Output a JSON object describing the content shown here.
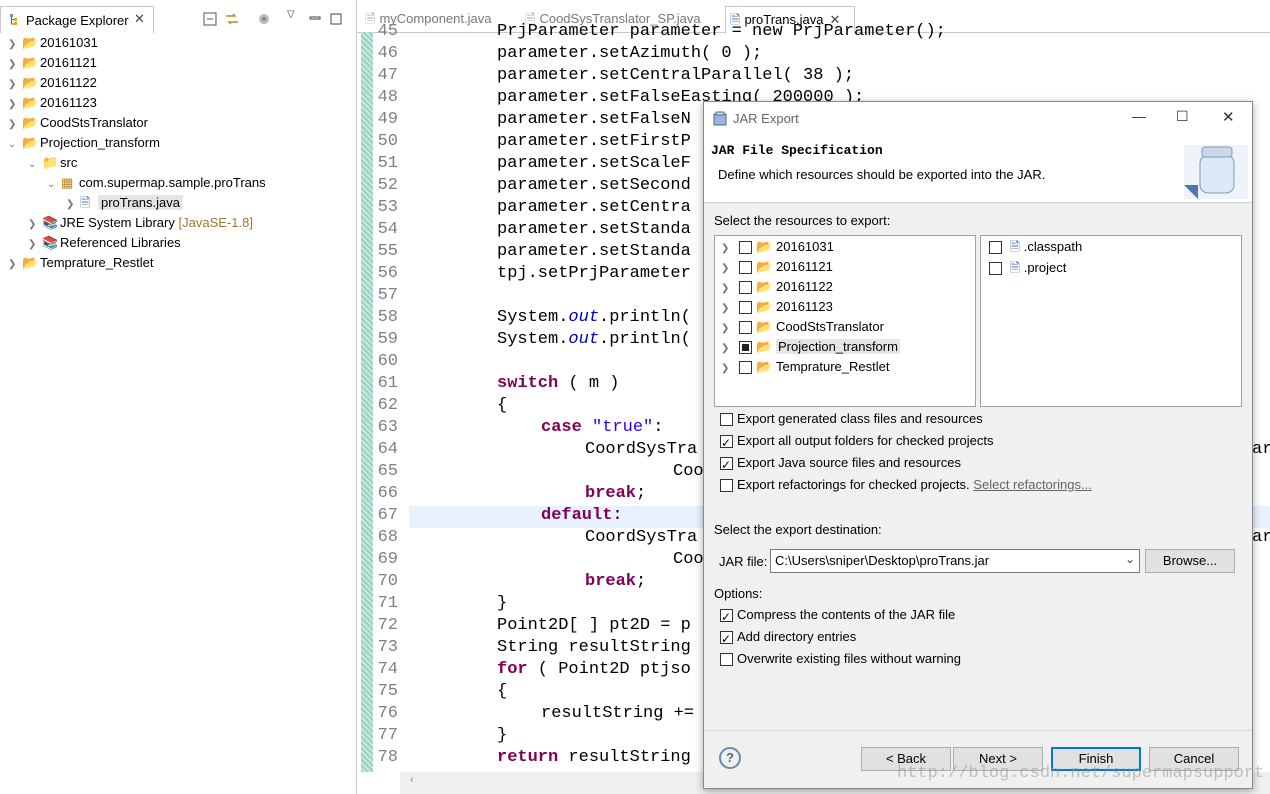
{
  "explorer": {
    "title": "Package Explorer",
    "tree": [
      {
        "label": "20161031",
        "arrow": ">"
      },
      {
        "label": "20161121",
        "arrow": ">"
      },
      {
        "label": "20161122",
        "arrow": ">"
      },
      {
        "label": "20161123",
        "arrow": ">"
      },
      {
        "label": "CoodStsTranslator",
        "arrow": ">"
      },
      {
        "label": "Projection_transform",
        "arrow": "v"
      },
      {
        "label": "src",
        "arrow": "v"
      },
      {
        "label": "com.supermap.sample.proTrans",
        "arrow": "v"
      },
      {
        "label": "proTrans.java",
        "arrow": ">"
      },
      {
        "label": "JRE System Library",
        "suffix": "[JavaSE-1.8]",
        "arrow": ">"
      },
      {
        "label": "Referenced Libraries",
        "arrow": ">"
      },
      {
        "label": "Temprature_Restlet",
        "arrow": ">"
      }
    ]
  },
  "editor": {
    "tabs": [
      "myComponent.java",
      "CoodSysTranslator_SP.java",
      "proTrans.java"
    ],
    "line_numbers": [
      "45",
      "46",
      "47",
      "48",
      "49",
      "50",
      "51",
      "52",
      "53",
      "54",
      "55",
      "56",
      "57",
      "58",
      "59",
      "60",
      "61",
      "62",
      "63",
      "64",
      "65",
      "66",
      "67",
      "68",
      "69",
      "70",
      "71",
      "72",
      "73",
      "74",
      "75",
      "76",
      "77",
      "78"
    ],
    "code": {
      "l45": "PrjParameter parameter = new PrjParameter();",
      "l46": "parameter.setAzimuth( 0 );",
      "l47": "parameter.setCentralParallel( 38 );",
      "l48": "parameter.setFalseEasting( 200000 );",
      "l49": "parameter.setFalseN",
      "l50": "parameter.setFirstP",
      "l51": "parameter.setScaleF",
      "l52": "parameter.setSecond",
      "l53": "parameter.setCentra",
      "l54": "parameter.setStanda",
      "l55": "parameter.setStanda",
      "l56": "tpj.setPrjParameter",
      "l58a": "System.",
      "l58b": "out",
      "l58c": ".println(",
      "l59a": "System.",
      "l59b": "out",
      "l59c": ".println(",
      "l61kw": "switch",
      "l61": " ( m )",
      "l62": "{",
      "l63kw": "case",
      "l63str": "\"true\"",
      "l63": ":",
      "l64": "CoordSysTra",
      "l64r": "ara",
      "l65": "Coo",
      "l66kw": "break",
      "l66": ";",
      "l67kw": "default",
      "l67": ":",
      "l68": "CoordSysTra",
      "l68r": "ara",
      "l69": "Coo",
      "l70kw": "break",
      "l70": ";",
      "l71": "}",
      "l72": "Point2D[ ] pt2D = p",
      "l73": "String resultString",
      "l74kw": "for",
      "l74": " ( Point2D ptjso",
      "l75": "{",
      "l76": "resultString +=",
      "l77": "}",
      "l78kw": "return",
      "l78": " resultString"
    }
  },
  "dialog": {
    "title": "JAR Export",
    "header_title": "JAR File Specification",
    "header_desc": "Define which resources should be exported into the JAR.",
    "resources_label": "Select the resources to export:",
    "resources": [
      {
        "label": "20161031",
        "state": "unchecked"
      },
      {
        "label": "20161121",
        "state": "unchecked"
      },
      {
        "label": "20161122",
        "state": "unchecked"
      },
      {
        "label": "20161123",
        "state": "unchecked"
      },
      {
        "label": "CoodStsTranslator",
        "state": "unchecked"
      },
      {
        "label": "Projection_transform",
        "state": "partial"
      },
      {
        "label": "Temprature_Restlet",
        "state": "unchecked"
      }
    ],
    "files": [
      {
        "label": ".classpath",
        "checked": false
      },
      {
        "label": ".project",
        "checked": false
      }
    ],
    "export_options": [
      {
        "label": "Export generated class files and resources",
        "checked": false
      },
      {
        "label": "Export all output folders for checked projects",
        "checked": true
      },
      {
        "label": "Export Java source files and resources",
        "checked": true
      },
      {
        "label": "Export refactorings for checked projects.",
        "checked": false
      }
    ],
    "select_refactorings_link": "Select refactorings...",
    "destination_label": "Select the export destination:",
    "jar_file_label": "JAR file:",
    "jar_file_value": "C:\\Users\\sniper\\Desktop\\proTrans.jar",
    "browse_label": "Browse...",
    "options_label": "Options:",
    "options": [
      {
        "label": "Compress the contents of the JAR file",
        "checked": true
      },
      {
        "label": "Add directory entries",
        "checked": true
      },
      {
        "label": "Overwrite existing files without warning",
        "checked": false
      }
    ],
    "buttons": {
      "back": "< Back",
      "next": "Next >",
      "finish": "Finish",
      "cancel": "Cancel"
    },
    "help_glyph": "?"
  },
  "watermark": "http://blog.csdn.net/supermapsupport"
}
